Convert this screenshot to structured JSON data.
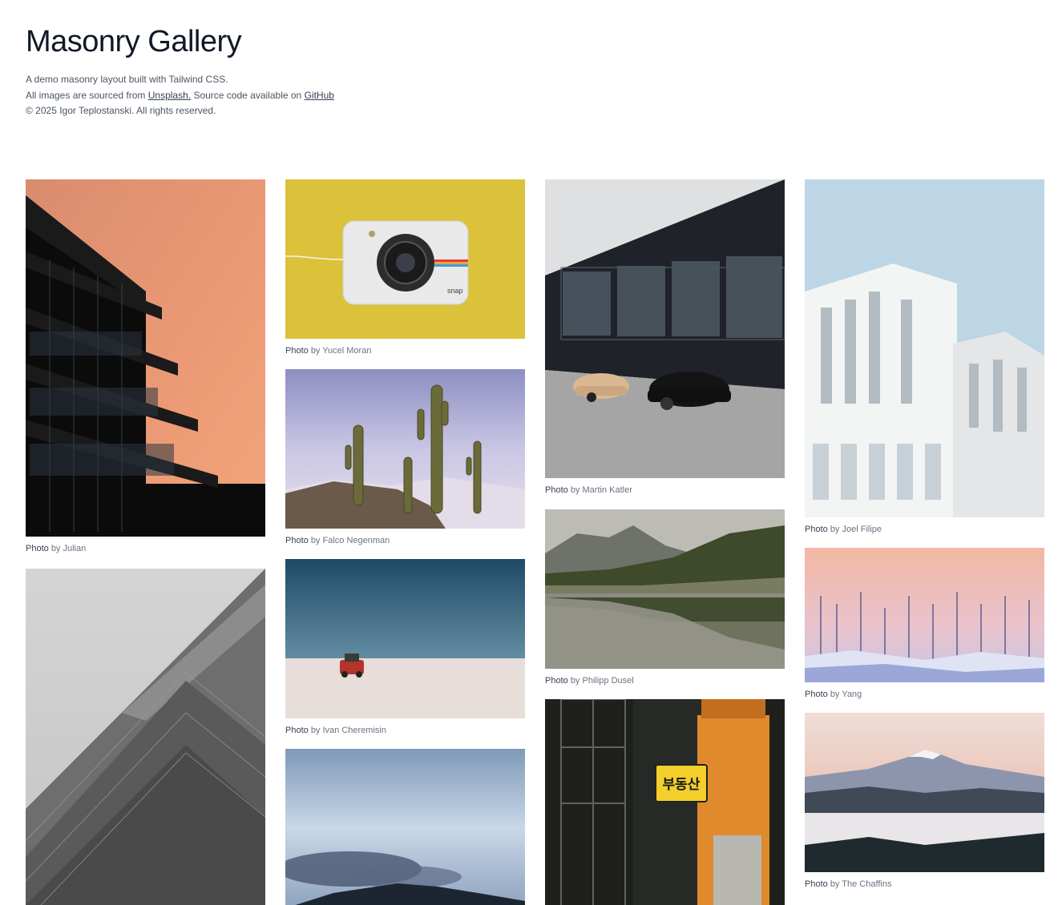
{
  "page": {
    "title": "Masonry Gallery",
    "line1": "A demo masonry layout built with Tailwind CSS.",
    "line2_prefix": "All images are sourced from",
    "line2_link1": "Unsplash.",
    "line2_middle": "Source code available on",
    "line2_link2": "GitHub",
    "line3": "© 2025 Igor Teplostanski. All rights reserved."
  },
  "caption_label": "Photo",
  "caption_by": "by",
  "photos": [
    {
      "author": "Julian",
      "subject": "orange-sky-glass-building"
    },
    {
      "author": "",
      "subject": "grey-stepped-facade"
    },
    {
      "author": "Yucel Moran",
      "subject": "snap-camera-on-yellow"
    },
    {
      "author": "Falco Negenman",
      "subject": "cacti-salt-flat"
    },
    {
      "author": "Ivan Cheremisin",
      "subject": "red-car-on-salt-flat"
    },
    {
      "author": "",
      "subject": "cloudy-sky-mountain"
    },
    {
      "author": "Martin Katler",
      "subject": "porsches-by-dark-building"
    },
    {
      "author": "Philipp Dusel",
      "subject": "lake-forest-reflection"
    },
    {
      "author": "",
      "subject": "korean-sign-storefront",
      "sign_text": "부동산"
    },
    {
      "author": "Joel Filipe",
      "subject": "white-modern-building"
    },
    {
      "author": "Yang",
      "subject": "pink-winter-trees"
    },
    {
      "author": "The Chaffins",
      "subject": "mountain-above-clouds"
    }
  ]
}
